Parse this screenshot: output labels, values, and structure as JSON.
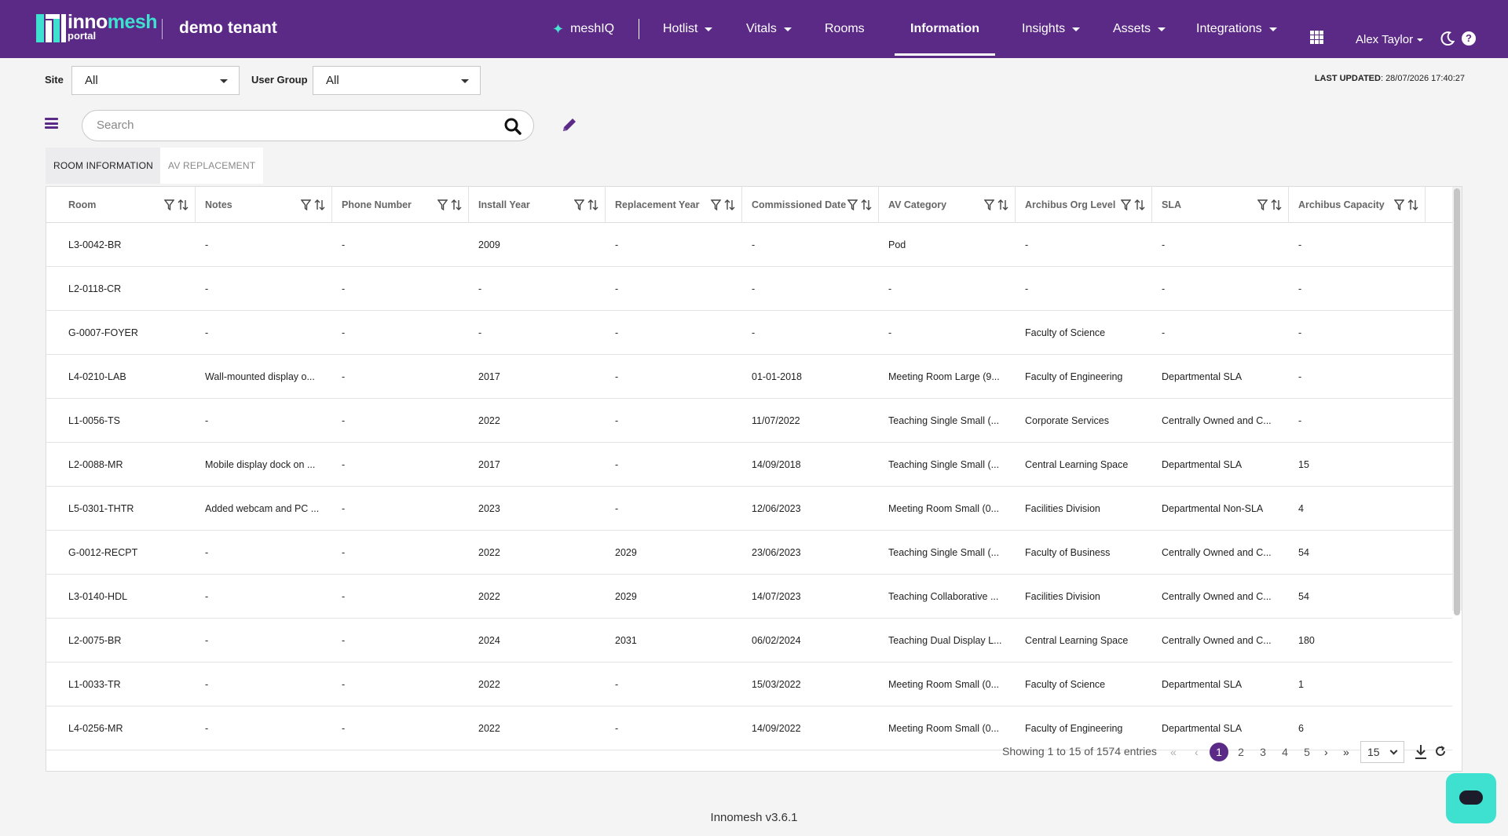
{
  "brand": {
    "name_a": "inno",
    "name_b": "mesh",
    "sub": "portal",
    "tenant": "demo tenant"
  },
  "nav": {
    "meshiq": "meshIQ",
    "hotlist": "Hotlist",
    "vitals": "Vitals",
    "rooms": "Rooms",
    "information": "Information",
    "insights": "Insights",
    "assets": "Assets",
    "integrations": "Integrations",
    "user": "Alex Taylor",
    "help": "?"
  },
  "filters": {
    "site_label": "Site",
    "site_value": "All",
    "user_group_label": "User Group",
    "user_group_value": "All",
    "last_updated_label": "LAST UPDATED",
    "last_updated_value": ": 28/07/2026 17:40:27"
  },
  "search": {
    "placeholder": "Search"
  },
  "tabs": {
    "room_information": "ROOM INFORMATION",
    "av_replacement": "AV REPLACEMENT"
  },
  "table": {
    "columns": [
      "Room",
      "Notes",
      "Phone Number",
      "Install Year",
      "Replacement Year",
      "Commissioned Date",
      "AV Category",
      "Archibus Org Level",
      "SLA",
      "Archibus Capacity"
    ],
    "rows": [
      [
        "L3-0042-BR",
        "-",
        "-",
        "2009",
        "-",
        "-",
        "Pod",
        "-",
        "-",
        "-"
      ],
      [
        "L2-0118-CR",
        "-",
        "-",
        "-",
        "-",
        "-",
        "-",
        "-",
        "-",
        "-"
      ],
      [
        "G-0007-FOYER",
        "-",
        "-",
        "-",
        "-",
        "-",
        "-",
        "Faculty of Science",
        "-",
        "-"
      ],
      [
        "L4-0210-LAB",
        "Wall-mounted display o...",
        "-",
        "2017",
        "-",
        "01-01-2018",
        "Meeting Room Large (9...",
        "Faculty of Engineering",
        "Departmental SLA",
        "-"
      ],
      [
        "L1-0056-TS",
        "-",
        "-",
        "2022",
        "-",
        "11/07/2022",
        "Teaching Single Small (...",
        "Corporate Services",
        "Centrally Owned and C...",
        "-"
      ],
      [
        "L2-0088-MR",
        "Mobile display dock on ...",
        "-",
        "2017",
        "-",
        "14/09/2018",
        "Teaching Single Small (...",
        "Central Learning Space",
        "Departmental SLA",
        "15"
      ],
      [
        "L5-0301-THTR",
        "Added webcam and PC ...",
        "-",
        "2023",
        "-",
        "12/06/2023",
        "Meeting Room Small (0...",
        "Facilities Division",
        "Departmental Non-SLA",
        "4"
      ],
      [
        "G-0012-RECPT",
        "-",
        "-",
        "2022",
        "2029",
        "23/06/2023",
        "Teaching Single Small (...",
        "Faculty of Business",
        "Centrally Owned and C...",
        "54"
      ],
      [
        "L3-0140-HDL",
        "-",
        "-",
        "2022",
        "2029",
        "14/07/2023",
        "Teaching Collaborative ...",
        "Facilities Division",
        "Centrally Owned and C...",
        "54"
      ],
      [
        "L2-0075-BR",
        "-",
        "-",
        "2024",
        "2031",
        "06/02/2024",
        "Teaching Dual Display L...",
        "Central Learning Space",
        "Centrally Owned and C...",
        "180"
      ],
      [
        "L1-0033-TR",
        "-",
        "-",
        "2022",
        "-",
        "15/03/2022",
        "Meeting Room Small (0...",
        "Faculty of Science",
        "Departmental SLA",
        "1"
      ],
      [
        "L4-0256-MR",
        "-",
        "-",
        "2022",
        "-",
        "14/09/2022",
        "Meeting Room Small (0...",
        "Faculty of Engineering",
        "Departmental SLA",
        "6"
      ]
    ]
  },
  "pagination": {
    "showing": "Showing 1 to 15 of 1574 entries",
    "pages": [
      "1",
      "2",
      "3",
      "4",
      "5"
    ],
    "current": "1",
    "page_size": "15"
  },
  "footer": {
    "version": "Innomesh v3.6.1"
  },
  "colors": {
    "header": "#5b2a86",
    "accent": "#3ee0d0"
  }
}
